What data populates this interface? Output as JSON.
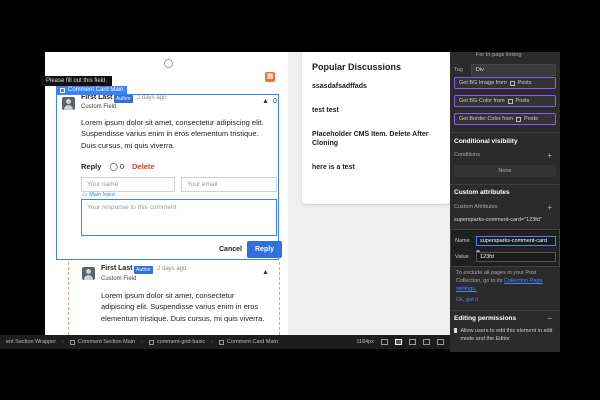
{
  "canvas": {
    "tooltip_warning": "Please fill out this field.",
    "selected_label": "Comment Card Main",
    "comment1": {
      "name": "First Last",
      "badge": "Author",
      "time": "2 days ago",
      "field": "Custom Field",
      "body": "Lorem ipsum dolor sit amet, consectetur adipiscing elit. Suspendisse varius enim in eros elementum tristique. Duis cursus, mi quis viverra.",
      "reply_label": "Reply",
      "comment_count": "0",
      "delete_label": "Delete",
      "name_placeholder": "Your name",
      "email_placeholder": "Your email",
      "main_input_label": "Main Input",
      "response_placeholder": "Your response to this comment",
      "cancel_label": "Cancel",
      "reply_button": "Reply"
    },
    "comment2": {
      "name": "First Last",
      "badge": "Author",
      "time": "2 days ago",
      "field": "Custom Field",
      "body": "Lorem ipsum dolor sit amet, consectetur adipiscing elit. Suspendisse varius enim in eros elementum tristique. Duis cursus, mi quis viverra."
    },
    "popular": {
      "title": "Popular Discussions",
      "items": [
        "ssasdafsadffads",
        "test test",
        "Placeholder CMS Item. Delete After Cloning",
        "here is a test"
      ]
    }
  },
  "bottom_bar": {
    "crumbs": [
      "ent Section Wrapper",
      "Comment Section Main",
      "comment-grid-basic",
      "Comment Card Main"
    ],
    "width_readout": "1184px"
  },
  "panel": {
    "top_text": "For In-page linking",
    "tag_label": "Tag",
    "tag_value": "Div",
    "bg_image_btn": "Get BG Image from",
    "bg_color_btn": "Get BG Color from",
    "border_color_btn": "Get Border Color from",
    "posts_label": "Posts",
    "conditional_visibility": "Conditional visibility",
    "conditions_label": "Conditions",
    "none_label": "None",
    "custom_attributes": "Custom attributes",
    "custom_attributes_sub": "Custom Attributes",
    "attr_row": "supersparks-comment-card=\"123fd\"",
    "popup_name_label": "Name",
    "popup_name_value": "supersparks-comment-card",
    "popup_value_label": "Value",
    "popup_value_value": "123fd",
    "info_text": "To exclude all pages in your Post Collection, go to its",
    "info_link": "Collection Page settings.",
    "ok_text": "Ok, got it",
    "editing_permissions": "Editing permissions",
    "permission_text": "Allow users to edit this element in edit mode and the Editor"
  },
  "colors": {
    "accent": "#2f6fe0",
    "selection": "#3b82f6",
    "delete": "#e23b3b",
    "panel_bg": "#2b2b2b",
    "purple": "#8b5cf6"
  }
}
